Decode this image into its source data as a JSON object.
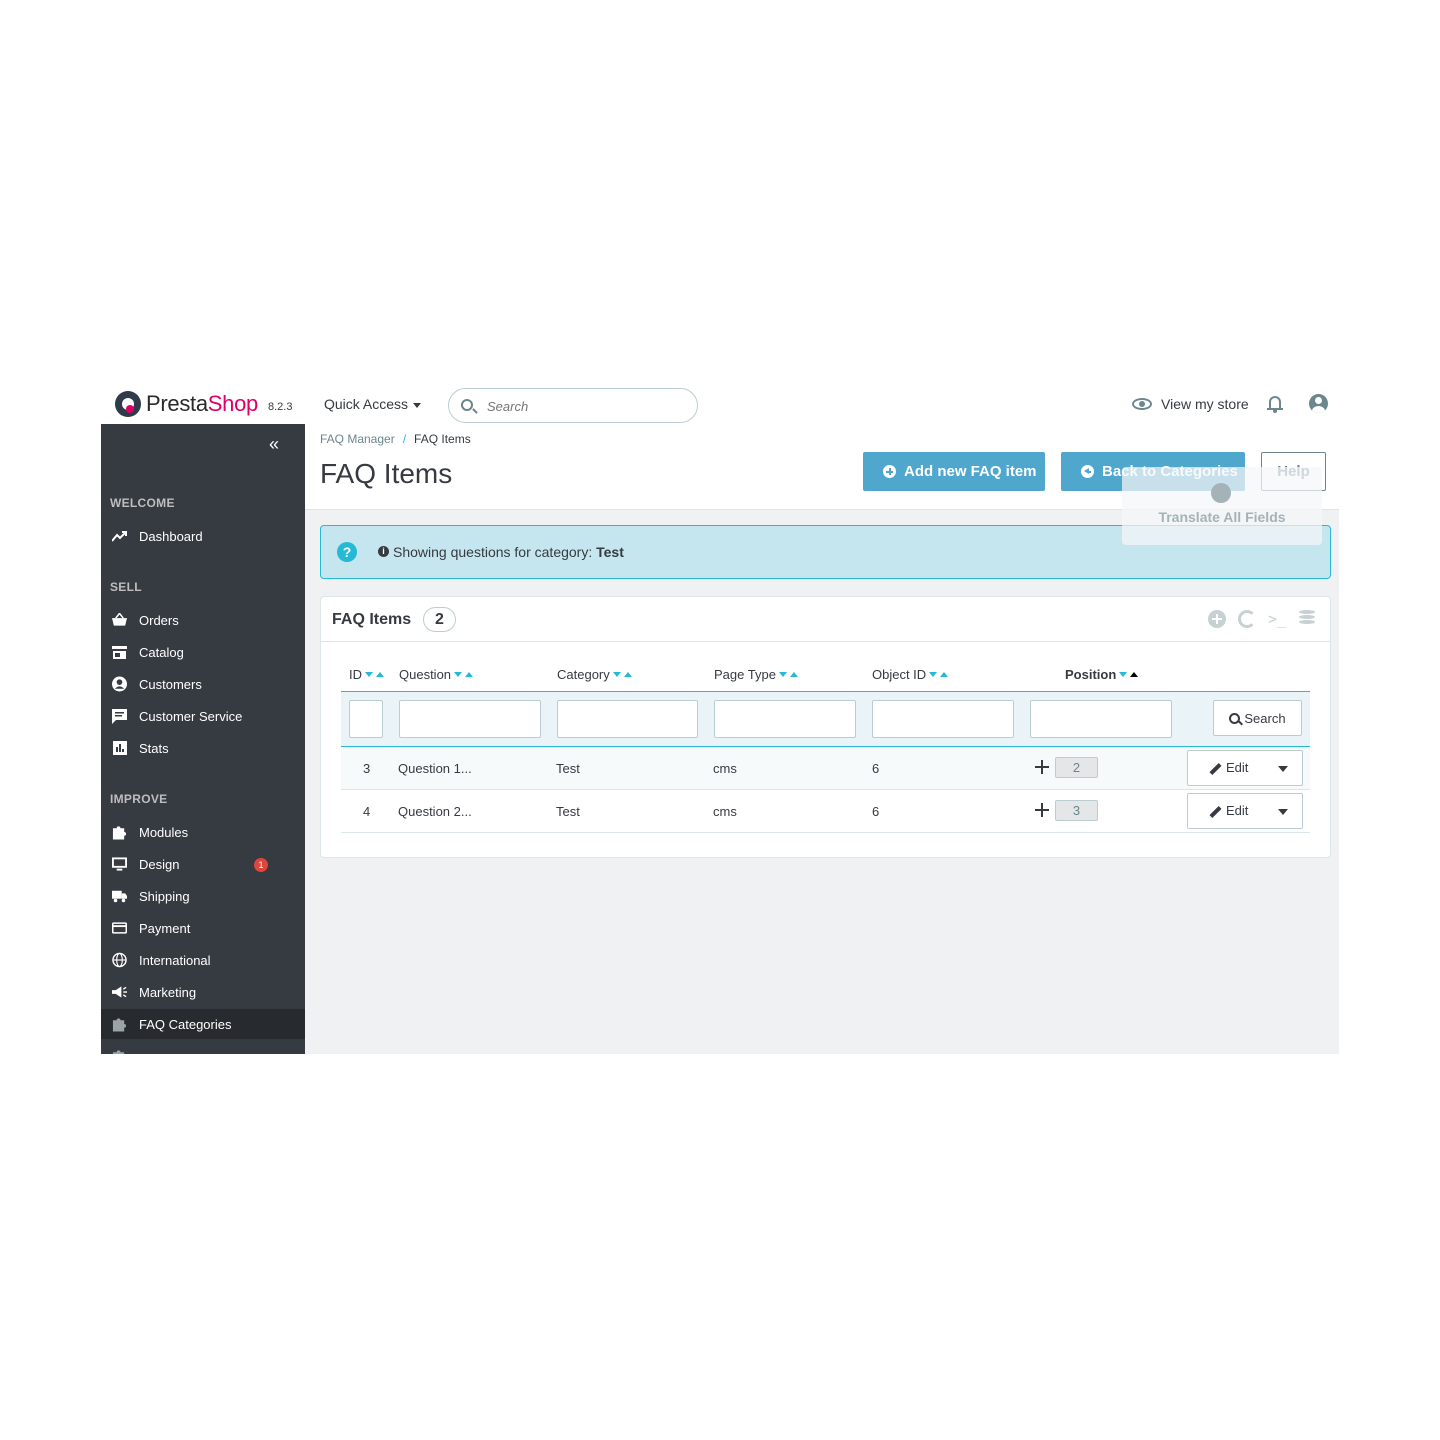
{
  "header": {
    "brand_part1": "Presta",
    "brand_part2": "Shop",
    "version": "8.2.3",
    "quick_access": "Quick Access",
    "search_placeholder": "Search",
    "view_store": "View my store"
  },
  "sidebar": {
    "collapse_icon": "«",
    "sections": {
      "welcome": "WELCOME",
      "sell": "SELL",
      "improve": "IMPROVE"
    },
    "items": {
      "dashboard": "Dashboard",
      "orders": "Orders",
      "catalog": "Catalog",
      "customers": "Customers",
      "customer_service": "Customer Service",
      "stats": "Stats",
      "modules": "Modules",
      "design": "Design",
      "design_badge": "1",
      "shipping": "Shipping",
      "payment": "Payment",
      "international": "International",
      "marketing": "Marketing",
      "faq_categories": "FAQ Categories"
    }
  },
  "breadcrumb": {
    "parent": "FAQ Manager",
    "separator": "/",
    "current": "FAQ Items"
  },
  "page": {
    "title": "FAQ Items",
    "add_button": "Add new FAQ item",
    "back_button": "Back to Categories",
    "help_button": "Help",
    "translate_all": "Translate All Fields"
  },
  "alert": {
    "prefix": "Showing questions for category:",
    "category": "Test"
  },
  "panel": {
    "title": "FAQ Items",
    "count": "2",
    "terminal_icon": ">_"
  },
  "table": {
    "columns": {
      "id": "ID",
      "question": "Question",
      "category": "Category",
      "page_type": "Page Type",
      "object_id": "Object ID",
      "position": "Position"
    },
    "search_button": "Search",
    "rows": [
      {
        "id": "3",
        "question": "Question 1...",
        "category": "Test",
        "page_type": "cms",
        "object_id": "6",
        "position": "2",
        "action": "Edit"
      },
      {
        "id": "4",
        "question": "Question 2...",
        "category": "Test",
        "page_type": "cms",
        "object_id": "6",
        "position": "3",
        "action": "Edit"
      }
    ]
  },
  "colors": {
    "accent": "#25b9d7",
    "primary_button": "#4fa7ce",
    "sidebar": "#363a41",
    "brand": "#df0067"
  }
}
